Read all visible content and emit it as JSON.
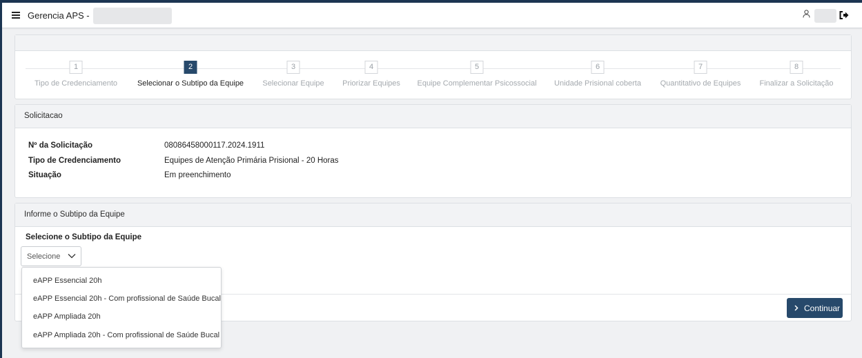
{
  "header": {
    "app_title": "Gerencia APS -",
    "user_name": "",
    "icons": {
      "menu": "hamburger-menu-icon",
      "user": "user-icon",
      "logout": "logout-icon"
    }
  },
  "stepper": {
    "active_step": 2,
    "steps": [
      {
        "number": "1",
        "label": "Tipo de Credenciamento"
      },
      {
        "number": "2",
        "label": "Selecionar o Subtipo da Equipe"
      },
      {
        "number": "3",
        "label": "Selecionar Equipe"
      },
      {
        "number": "4",
        "label": "Priorizar Equipes"
      },
      {
        "number": "5",
        "label": "Equipe Complementar Psicossocial"
      },
      {
        "number": "6",
        "label": "Unidade Prisional coberta"
      },
      {
        "number": "7",
        "label": "Quantitativo de Equipes"
      },
      {
        "number": "8",
        "label": "Finalizar a Solicitação"
      }
    ]
  },
  "solicitacao": {
    "title": "Solicitacao",
    "fields": [
      {
        "label": "Nº da Solicitação",
        "value": "08086458000117.2024.1911"
      },
      {
        "label": "Tipo de Credenciamento",
        "value": "Equipes de Atenção Primária Prisional - 20 Horas"
      },
      {
        "label": "Situação",
        "value": "Em preenchimento"
      }
    ]
  },
  "subtipo": {
    "title": "Informe o Subtipo da Equipe",
    "field_label": "Selecione o Subtipo da Equipe",
    "select_value": "Selecione",
    "options": [
      "eAPP Essencial 20h",
      "eAPP Essencial 20h - Com profissional de Saúde Bucal",
      "eAPP Ampliada 20h",
      "eAPP Ampliada 20h - Com profissional de Saúde Bucal"
    ]
  },
  "actions": {
    "continue_label": "Continuar"
  },
  "colors": {
    "primary": "#27496b",
    "frame": "#1c3552",
    "page_bg": "#f0f1f3",
    "header_bg": "#f2f3f5"
  }
}
